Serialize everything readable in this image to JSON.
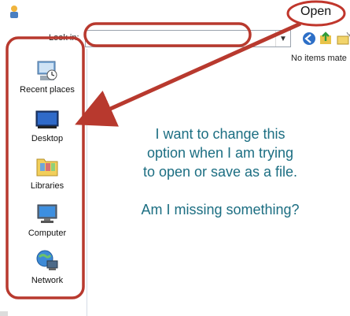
{
  "window": {
    "title": "Open"
  },
  "lookin": {
    "label": "Look in:",
    "value": ""
  },
  "file_list": {
    "empty_text": "No items mate"
  },
  "places": [
    {
      "label": "Recent places",
      "icon": "recent-places-icon"
    },
    {
      "label": "Desktop",
      "icon": "desktop-icon"
    },
    {
      "label": "Libraries",
      "icon": "libraries-icon"
    },
    {
      "label": "Computer",
      "icon": "computer-icon"
    },
    {
      "label": "Network",
      "icon": "network-icon"
    }
  ],
  "annotation": {
    "lines": [
      "I want to change this",
      "option when I am trying",
      "to open or save as a file."
    ],
    "question": "Am I missing something?"
  },
  "colors": {
    "annotation_red": "#b8392e",
    "annotation_text": "#1c6e82"
  }
}
